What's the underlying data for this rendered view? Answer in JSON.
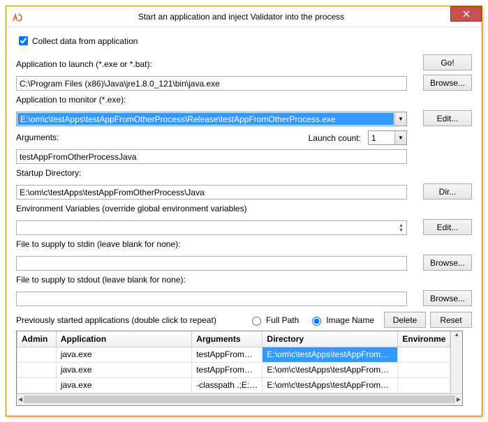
{
  "window": {
    "title": "Start an application and inject Validator into the process"
  },
  "checkbox": {
    "collect_label": "Collect data from application",
    "collect_checked": true
  },
  "fields": {
    "app_launch_label": "Application to launch (*.exe or *.bat):",
    "app_launch_value": "C:\\Program Files (x86)\\Java\\jre1.8.0_121\\bin\\java.exe",
    "app_monitor_label": "Application to monitor (*.exe):",
    "app_monitor_value": "E:\\om\\c\\testApps\\testAppFromOtherProcess\\Release\\testAppFromOtherProcess.exe",
    "arguments_label": "Arguments:",
    "arguments_value": "testAppFromOtherProcessJava",
    "launch_count_label": "Launch count:",
    "launch_count_value": "1",
    "startup_dir_label": "Startup Directory:",
    "startup_dir_value": "E:\\om\\c\\testApps\\testAppFromOtherProcess\\Java",
    "env_vars_label": "Environment Variables (override global environment variables)",
    "env_vars_value": "",
    "stdin_label": "File to supply to stdin (leave blank for none):",
    "stdin_value": "",
    "stdout_label": "File to supply to stdout (leave blank for none):",
    "stdout_value": ""
  },
  "buttons": {
    "go": "Go!",
    "browse": "Browse...",
    "edit": "Edit...",
    "dir": "Dir...",
    "delete": "Delete",
    "reset": "Reset"
  },
  "table_section": {
    "caption": "Previously started applications (double click to repeat)",
    "radio_full": "Full Path",
    "radio_image": "Image Name",
    "headers": {
      "admin": "Admin",
      "application": "Application",
      "arguments": "Arguments",
      "directory": "Directory",
      "environment": "Environme"
    },
    "rows": [
      {
        "admin": "",
        "application": "java.exe",
        "arguments": "testAppFromOt...",
        "directory": "E:\\om\\c\\testApps\\testAppFromOt...",
        "selected": true
      },
      {
        "admin": "",
        "application": "java.exe",
        "arguments": "testAppFromOt...",
        "directory": "E:\\om\\c\\testApps\\testAppFromOth..."
      },
      {
        "admin": "",
        "application": "java.exe",
        "arguments": "-classpath .;E:\\o...",
        "directory": "E:\\om\\c\\testApps\\testAppFromOth..."
      }
    ]
  }
}
